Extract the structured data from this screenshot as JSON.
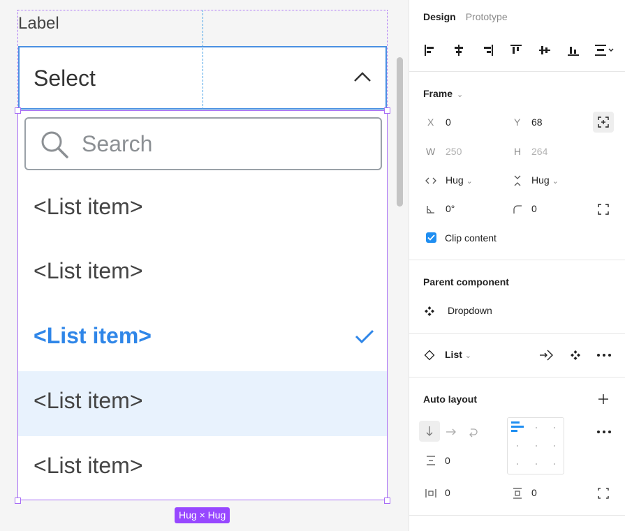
{
  "canvas": {
    "label": "Label",
    "select": {
      "value": "Select"
    },
    "search": {
      "placeholder": "Search"
    },
    "list_items": [
      {
        "label": "<List item>",
        "state": "default"
      },
      {
        "label": "<List item>",
        "state": "default"
      },
      {
        "label": "<List item>",
        "state": "selected"
      },
      {
        "label": "<List item>",
        "state": "hovered"
      },
      {
        "label": "<List item>",
        "state": "default"
      }
    ],
    "size_badge": "Hug × Hug"
  },
  "panel": {
    "tabs": {
      "design": "Design",
      "prototype": "Prototype"
    },
    "frame": {
      "title": "Frame",
      "x_label": "X",
      "x_value": "0",
      "y_label": "Y",
      "y_value": "68",
      "w_label": "W",
      "w_value": "250",
      "h_label": "H",
      "h_value": "264",
      "width_mode": "Hug",
      "height_mode": "Hug",
      "rotation": "0°",
      "corner_radius": "0",
      "clip_content_label": "Clip content",
      "clip_content_checked": true
    },
    "parent_component": {
      "title": "Parent component",
      "name": "Dropdown"
    },
    "instance": {
      "name": "List"
    },
    "auto_layout": {
      "title": "Auto layout",
      "gap": "0",
      "padding_horizontal": "0",
      "padding_vertical": "0"
    }
  },
  "colors": {
    "accent": "#2f86e8",
    "selection": "#9747ff",
    "hover_bg": "#e8f2fd",
    "checkbox": "#1f8ef1"
  },
  "icons": [
    "chevron-up-icon",
    "search-icon",
    "check-icon",
    "align-left-icon",
    "align-horizontal-center-icon",
    "align-right-icon",
    "align-top-icon",
    "align-vertical-center-icon",
    "align-bottom-icon",
    "distribute-icon",
    "focus-frame-icon",
    "resize-to-fit-icon",
    "component-icon",
    "instance-icon",
    "go-to-main-icon",
    "more-icon",
    "plus-icon",
    "arrow-down-icon",
    "arrow-right-icon",
    "wrap-icon"
  ]
}
